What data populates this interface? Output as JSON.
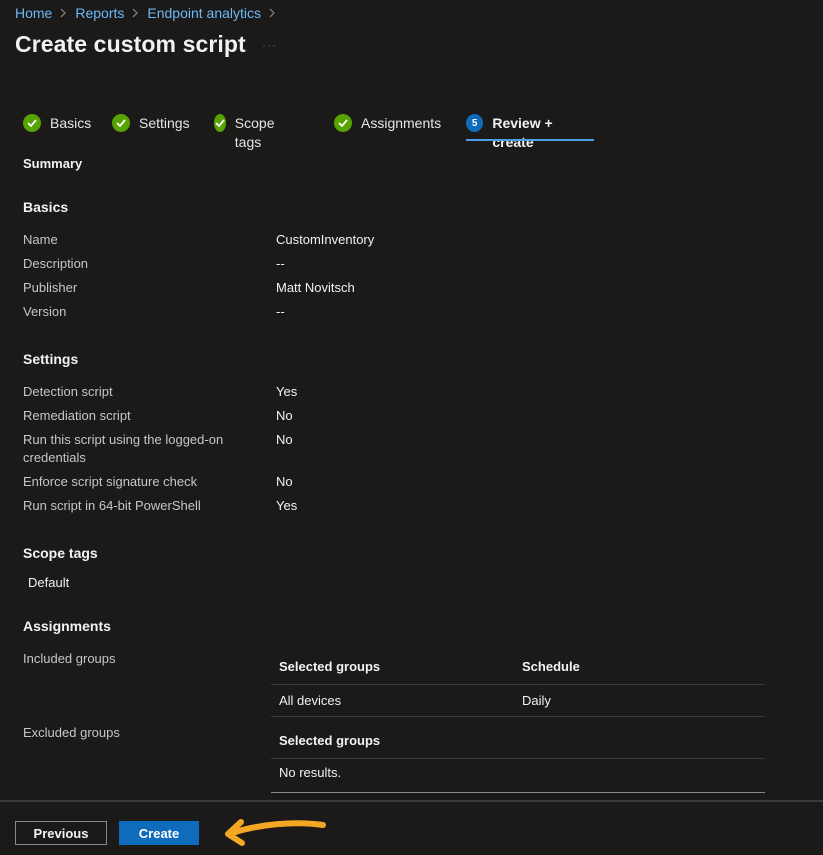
{
  "breadcrumb": [
    "Home",
    "Reports",
    "Endpoint analytics"
  ],
  "page": {
    "title": "Create custom script"
  },
  "tabs": [
    {
      "label": "Basics",
      "status": "complete"
    },
    {
      "label": "Settings",
      "status": "complete"
    },
    {
      "label": "Scope tags",
      "status": "complete"
    },
    {
      "label": "Assignments",
      "status": "complete"
    },
    {
      "label": "Review + create",
      "status": "current",
      "step": "5"
    }
  ],
  "summary": {
    "heading": "Summary"
  },
  "basics": {
    "heading": "Basics",
    "rows": [
      {
        "label": "Name",
        "value": "CustomInventory"
      },
      {
        "label": "Description",
        "value": "--"
      },
      {
        "label": "Publisher",
        "value": "Matt Novitsch"
      },
      {
        "label": "Version",
        "value": "--"
      }
    ]
  },
  "settings": {
    "heading": "Settings",
    "rows": [
      {
        "label": "Detection script",
        "value": "Yes"
      },
      {
        "label": "Remediation script",
        "value": "No"
      },
      {
        "label": "Run this script using the logged-on credentials",
        "value": "No"
      },
      {
        "label": "Enforce script signature check",
        "value": "No"
      },
      {
        "label": "Run script in 64-bit PowerShell",
        "value": "Yes"
      }
    ]
  },
  "scope_tags": {
    "heading": "Scope tags",
    "value": "Default"
  },
  "assignments": {
    "heading": "Assignments",
    "included": {
      "label": "Included groups",
      "columns": [
        "Selected groups",
        "Schedule"
      ],
      "rows": [
        [
          "All devices",
          "Daily"
        ]
      ]
    },
    "excluded": {
      "label": "Excluded groups",
      "columns": [
        "Selected groups"
      ],
      "empty_text": "No results."
    }
  },
  "footer": {
    "previous_label": "Previous",
    "create_label": "Create"
  },
  "colors": {
    "accent": "#0f6cbd",
    "link": "#6cb8f6",
    "success": "#57a300",
    "annotation_arrow": "#f5a623"
  }
}
